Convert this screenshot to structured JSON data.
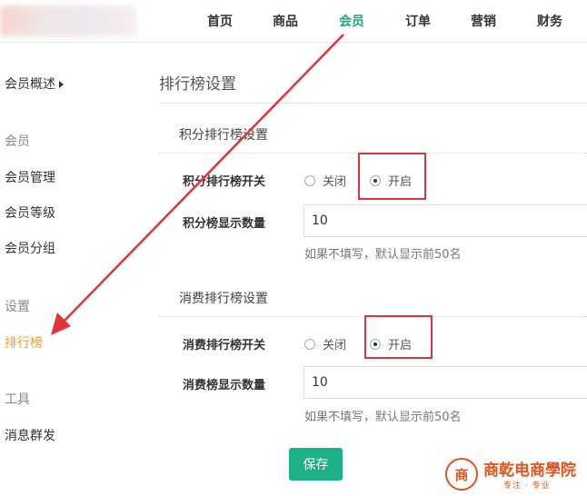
{
  "nav": {
    "items": [
      {
        "label": "首页",
        "active": false
      },
      {
        "label": "商品",
        "active": false
      },
      {
        "label": "会员",
        "active": true
      },
      {
        "label": "订单",
        "active": false
      },
      {
        "label": "营销",
        "active": false
      },
      {
        "label": "财务",
        "active": false
      }
    ]
  },
  "sidebar": {
    "overview": "会员概述",
    "cat_member": "会员",
    "member_manage": "会员管理",
    "member_level": "会员等级",
    "member_group": "会员分组",
    "cat_settings": "设置",
    "ranking": "排行榜",
    "cat_tools": "工具",
    "mass_message": "消息群发"
  },
  "main": {
    "page_title": "排行榜设置",
    "points": {
      "section_title": "积分排行榜设置",
      "switch_label": "积分排行榜开关",
      "off_label": "关闭",
      "on_label": "开启",
      "selected": "on",
      "count_label": "积分榜显示数量",
      "count_value": "10",
      "hint": "如果不填写，默认显示前50名"
    },
    "spend": {
      "section_title": "消费排行榜设置",
      "switch_label": "消费排行榜开关",
      "off_label": "关闭",
      "on_label": "开启",
      "selected": "on",
      "count_label": "消费榜显示数量",
      "count_value": "10",
      "hint": "如果不填写，默认显示前50名"
    },
    "save_label": "保存"
  },
  "watermark": {
    "name": "商乾电商學院",
    "sub": "专注 · 专业"
  },
  "colors": {
    "accent": "#1aa97b",
    "sidebar_active": "#f0a030",
    "highlight": "#e1333a",
    "save_button": "#1cb189",
    "watermark": "#e2531e"
  }
}
